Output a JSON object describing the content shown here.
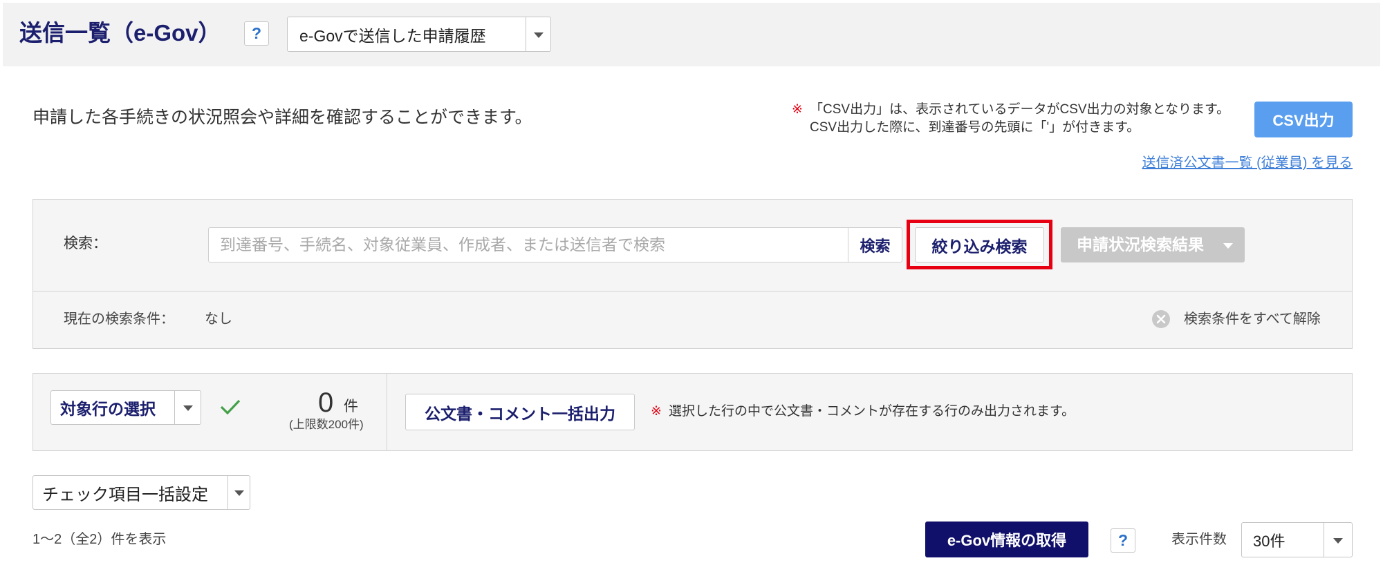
{
  "header": {
    "title": "送信一覧（e-Gov）",
    "help_label": "?",
    "view_select": {
      "value": "e-Govで送信した申請履歴"
    }
  },
  "intro": {
    "description": "申請した各手続きの状況照会や詳細を確認することができます。",
    "note_mark": "※",
    "note_line1": "「CSV出力」は、表示されているデータがCSV出力の対象となります。",
    "note_line2": "CSV出力した際に、到達番号の先頭に「'」が付きます。",
    "csv_button": "CSV出力",
    "archive_link": "送信済公文書一覧 (従業員) を見る"
  },
  "search": {
    "label": "検索：",
    "placeholder": "到達番号、手続名、対象従業員、作成者、または送信者で検索",
    "value": "",
    "search_button": "検索",
    "filter_button": "絞り込み検索",
    "status_button": "申請状況検索結果",
    "conditions_label": "現在の検索条件：",
    "conditions_value": "なし",
    "clear_all": "検索条件をすべて解除"
  },
  "selection": {
    "row_select": "対象行の選択",
    "count": "0",
    "count_unit": "件",
    "limit": "(上限数200件)",
    "bulk_output_button": "公文書・コメント一括出力",
    "note_mark": "※",
    "note": "選択した行の中で公文書・コメントが存在する行のみ出力されます。"
  },
  "bulk_check": {
    "value": "チェック項目一括設定"
  },
  "footer": {
    "result_count": "1〜2（全2）件を表示",
    "fetch_button": "e-Gov情報の取得",
    "help_label": "?",
    "page_size_label": "表示件数",
    "page_size_value": "30件"
  },
  "icons": {
    "help": "help-icon",
    "dropdown": "chevron-down-icon",
    "clear": "clear-circle-icon",
    "check": "checkmark-icon"
  },
  "colors": {
    "title": "#1b1f6d",
    "navy_button": "#10106b",
    "csv_button": "#5a9ef0",
    "link": "#3f7fd8",
    "alert_red": "#e60012",
    "check_green": "#43a047",
    "disabled_button": "#c8c8c8",
    "panel_bg": "#f5f5f5",
    "header_bg": "#f2f2f2"
  }
}
